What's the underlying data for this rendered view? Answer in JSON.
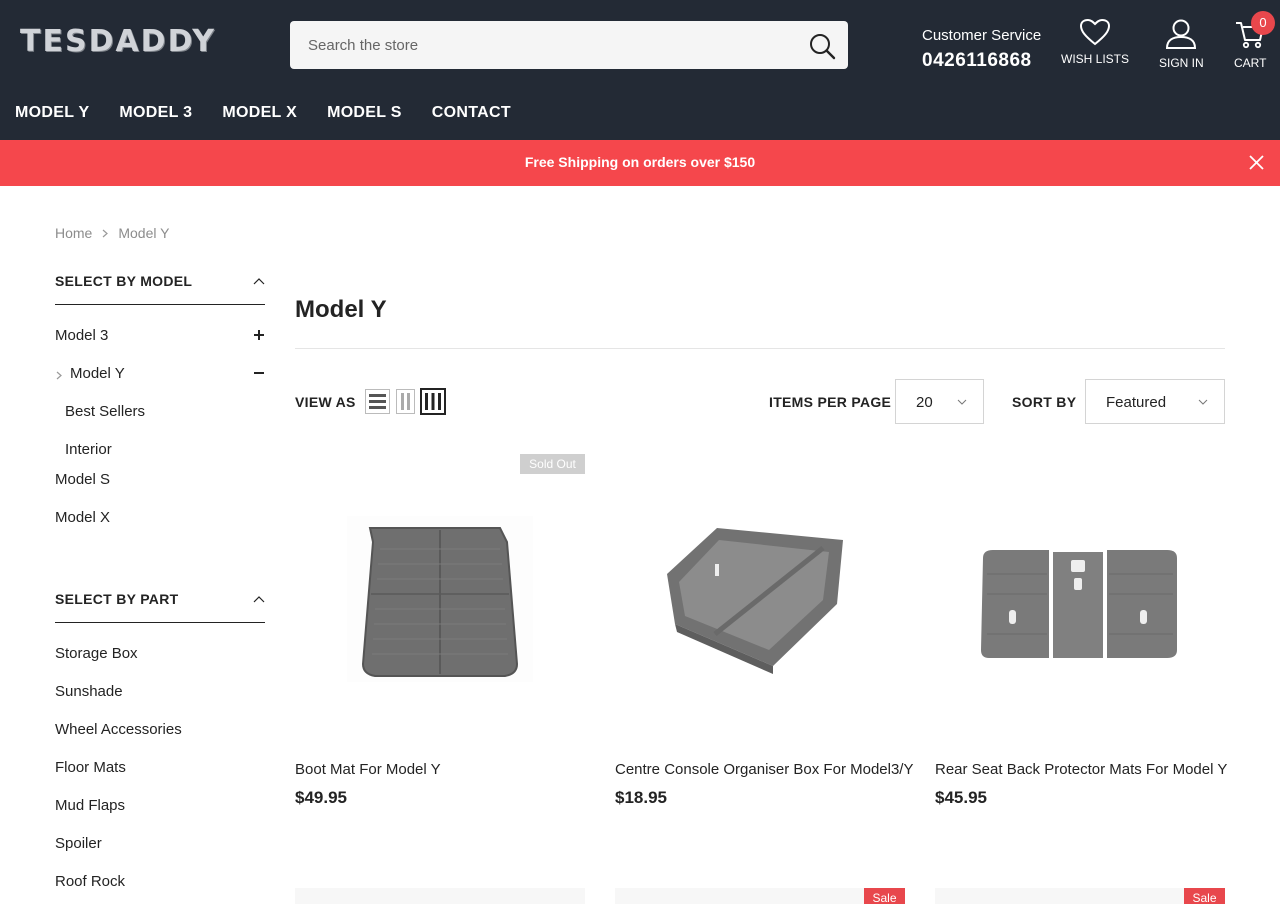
{
  "header": {
    "logo": "TESDADDY",
    "search_placeholder": "Search the store",
    "customer_service_label": "Customer Service",
    "phone": "0426116868",
    "wishlist_label": "WISH LISTS",
    "signin_label": "SIGN IN",
    "cart_label": "CART",
    "cart_count": "0"
  },
  "nav": [
    "MODEL Y",
    "MODEL 3",
    "MODEL X",
    "MODEL S",
    "CONTACT"
  ],
  "banner": {
    "text": "Free Shipping on orders over $150",
    "color": "#f5474c"
  },
  "breadcrumb": [
    "Home",
    "Model Y"
  ],
  "sidebar": {
    "model_heading": "SELECT BY MODEL",
    "models": [
      "Model 3",
      "Model Y",
      "Best Sellers",
      "Interior",
      "Model S",
      "Model X"
    ],
    "part_heading": "SELECT BY PART",
    "parts": [
      "Storage Box",
      "Sunshade",
      "Wheel Accessories",
      "Floor Mats",
      "Mud Flaps",
      "Spoiler",
      "Roof Rock"
    ]
  },
  "main": {
    "title": "Model Y",
    "view_as_label": "VIEW AS",
    "items_per_page_label": "ITEMS PER PAGE",
    "items_per_page_value": "20",
    "sort_by_label": "SORT BY",
    "sort_by_value": "Featured"
  },
  "products": [
    {
      "name": "Boot Mat For Model Y",
      "price": "$49.95",
      "badge": "Sold Out"
    },
    {
      "name": "Centre Console Organiser Box For Model3/Y",
      "price": "$18.95"
    },
    {
      "name": "Rear Seat Back Protector Mats For Model Y",
      "price": "$45.95"
    }
  ],
  "next_row_badges": [
    "Sale",
    "Sale"
  ],
  "colors": {
    "header_bg": "#232a35",
    "accent": "#e8474c"
  }
}
